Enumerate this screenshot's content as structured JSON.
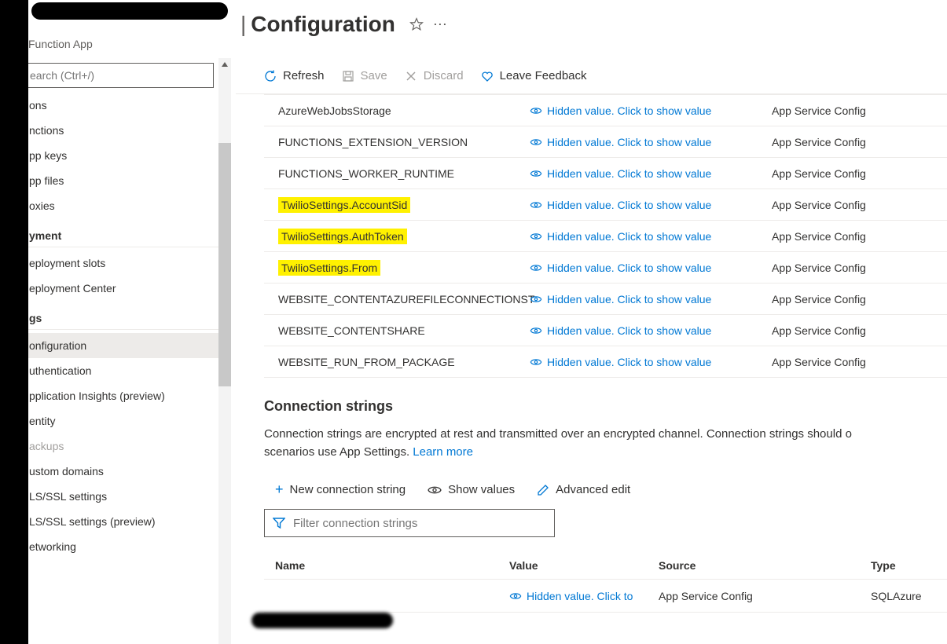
{
  "header": {
    "title": "Configuration",
    "subtitle": "Function App"
  },
  "sidebar": {
    "search_placeholder": "earch (Ctrl+/)",
    "items": [
      {
        "type": "item",
        "label": "ons",
        "kind": "cut"
      },
      {
        "type": "item",
        "label": "nctions",
        "kind": "normal"
      },
      {
        "type": "item",
        "label": "pp keys",
        "kind": "normal"
      },
      {
        "type": "item",
        "label": "pp files",
        "kind": "normal"
      },
      {
        "type": "item",
        "label": "oxies",
        "kind": "normal"
      },
      {
        "type": "group",
        "label": "yment"
      },
      {
        "type": "item",
        "label": "eployment slots",
        "kind": "normal"
      },
      {
        "type": "item",
        "label": "eployment Center",
        "kind": "normal"
      },
      {
        "type": "group",
        "label": "gs"
      },
      {
        "type": "item",
        "label": "onfiguration",
        "kind": "selected"
      },
      {
        "type": "item",
        "label": "uthentication",
        "kind": "normal"
      },
      {
        "type": "item",
        "label": "pplication Insights (preview)",
        "kind": "normal"
      },
      {
        "type": "item",
        "label": "entity",
        "kind": "normal"
      },
      {
        "type": "item",
        "label": "ackups",
        "kind": "disabled"
      },
      {
        "type": "item",
        "label": "ustom domains",
        "kind": "normal"
      },
      {
        "type": "item",
        "label": "LS/SSL settings",
        "kind": "normal"
      },
      {
        "type": "item",
        "label": "LS/SSL settings (preview)",
        "kind": "normal"
      },
      {
        "type": "item",
        "label": "etworking",
        "kind": "normal"
      }
    ]
  },
  "toolbar": {
    "refresh": "Refresh",
    "save": "Save",
    "discard": "Discard",
    "feedback": "Leave Feedback"
  },
  "app_settings": {
    "hidden_label": "Hidden value. Click to show value",
    "source_label": "App Service Config",
    "rows": [
      {
        "name": "AzureWebJobsStorage",
        "highlight": false
      },
      {
        "name": "FUNCTIONS_EXTENSION_VERSION",
        "highlight": false
      },
      {
        "name": "FUNCTIONS_WORKER_RUNTIME",
        "highlight": false
      },
      {
        "name": "TwilioSettings.AccountSid",
        "highlight": true
      },
      {
        "name": "TwilioSettings.AuthToken",
        "highlight": true
      },
      {
        "name": "TwilioSettings.From",
        "highlight": true
      },
      {
        "name": "WEBSITE_CONTENTAZUREFILECONNECTIONST",
        "highlight": false
      },
      {
        "name": "WEBSITE_CONTENTSHARE",
        "highlight": false
      },
      {
        "name": "WEBSITE_RUN_FROM_PACKAGE",
        "highlight": false
      }
    ]
  },
  "connection_strings": {
    "title": "Connection strings",
    "desc_prefix": "Connection strings are encrypted at rest and transmitted over an encrypted channel. Connection strings should o",
    "desc_line2_prefix": "scenarios use App Settings. ",
    "learn_more": "Learn more",
    "new_btn": "New connection string",
    "show_values": "Show values",
    "advanced_edit": "Advanced edit",
    "filter_placeholder": "Filter connection strings",
    "headers": {
      "name": "Name",
      "value": "Value",
      "source": "Source",
      "type": "Type"
    },
    "row": {
      "value_label": "Hidden value. Click to",
      "source": "App Service Config",
      "type": "SQLAzure"
    }
  }
}
